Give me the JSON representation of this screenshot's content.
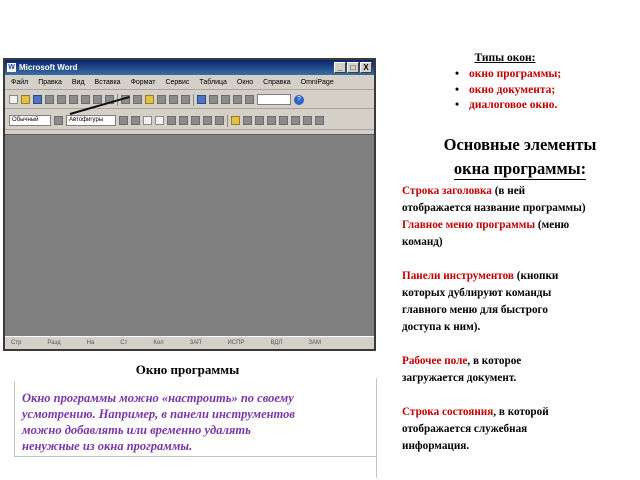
{
  "window": {
    "title": "Microsoft Word",
    "app_icon": "W",
    "controls": [
      "_",
      "□",
      "X"
    ],
    "menu": [
      "Файл",
      "Правка",
      "Вид",
      "Вставка",
      "Формат",
      "Сервис",
      "Таблица",
      "Окно",
      "Справка",
      "OmniPage"
    ],
    "style_combo": "Обычный",
    "font_combo": "Автофигуры",
    "help_glyph": "?",
    "status": [
      "Стр",
      "Разд",
      "На",
      "Ст",
      "Кол",
      "ЗАП",
      "ИСПР",
      "ВДЛ",
      "ЗАМ"
    ]
  },
  "caption": "Окно программы",
  "note_lines": [
    "Окно программы можно «настроить» по своему",
    "усмотрению. Например, в панели инструментов",
    "можно добавлять или временно удалять",
    "ненужные из окна программы."
  ],
  "types": {
    "title": "Типы окон:",
    "items": [
      "окно программы;",
      "окно документа;",
      "диалоговое окно."
    ]
  },
  "elements_title": {
    "line1": "Основные элементы",
    "line2": "окна программы:"
  },
  "elements": [
    {
      "term": "Строка заголовка",
      "rest_1": " (в ней",
      "lines": [
        "отображается название программы)"
      ]
    },
    {
      "term": "Главное меню программы",
      "rest_1": " (меню",
      "lines": [
        "команд)"
      ]
    },
    {
      "term": "Панели инструментов",
      "rest_1": " (кнопки",
      "lines": [
        "которых дублируют команды",
        "главного меню для быстрого",
        "доступа к ним)."
      ]
    },
    {
      "term": "Рабочее поле",
      "rest_1": ", в которое",
      "lines": [
        "загружается документ."
      ]
    },
    {
      "term": "Строка состояния",
      "rest_1": ", в которой",
      "lines": [
        "отображается служебная",
        "информация."
      ]
    }
  ],
  "colors": {
    "highlight": "#c00000",
    "note": "#7a35a8",
    "workspace": "#808080"
  }
}
